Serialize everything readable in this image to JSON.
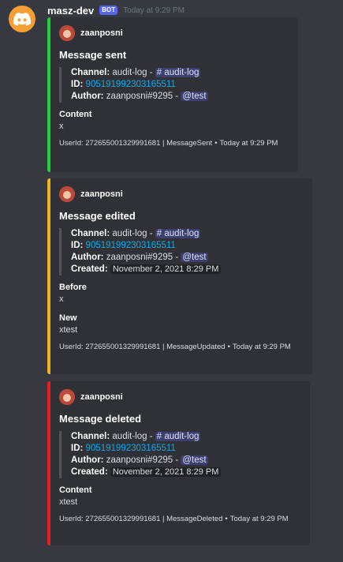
{
  "bot": {
    "name": "masz-dev",
    "tag": "BOT",
    "timestamp": "Today at 9:29 PM",
    "avatar_icon": "discord-logo-icon",
    "avatar_color": "#f59f35"
  },
  "embeds": [
    {
      "color": "#22d13a",
      "author": "zaanposni",
      "title": "Message sent",
      "quote": {
        "channel_label": "Channel:",
        "channel_text": "audit-log -",
        "channel_mention": "# audit-log",
        "id_label": "ID:",
        "id_value": "905191992303165511",
        "author_label": "Author:",
        "author_text": "zaanposni#9295 -",
        "author_mention": "@test"
      },
      "fields": [
        {
          "name": "Content",
          "value": "x"
        }
      ],
      "footer": "UserId: 272655001329991681 | MessageSent",
      "footer_time": "Today at 9:29 PM"
    },
    {
      "color": "#f5b11c",
      "author": "zaanposni",
      "title": "Message edited",
      "quote": {
        "channel_label": "Channel:",
        "channel_text": "audit-log -",
        "channel_mention": "# audit-log",
        "id_label": "ID:",
        "id_value": "905191992303165511",
        "author_label": "Author:",
        "author_text": "zaanposni#9295 -",
        "author_mention": "@test",
        "created_label": "Created:",
        "created_value": "November 2, 2021 8:29 PM"
      },
      "fields": [
        {
          "name": "Before",
          "value": "x"
        },
        {
          "name": "New",
          "value": "xtest"
        }
      ],
      "footer": "UserId: 272655001329991681 | MessageUpdated",
      "footer_time": "Today at 9:29 PM"
    },
    {
      "color": "#ec1e1e",
      "author": "zaanposni",
      "title": "Message deleted",
      "quote": {
        "channel_label": "Channel:",
        "channel_text": "audit-log -",
        "channel_mention": "# audit-log",
        "id_label": "ID:",
        "id_value": "905191992303165511",
        "author_label": "Author:",
        "author_text": "zaanposni#9295 -",
        "author_mention": "@test",
        "created_label": "Created:",
        "created_value": "November 2, 2021 8:29 PM"
      },
      "fields": [
        {
          "name": "Content",
          "value": "xtest"
        }
      ],
      "footer": "UserId: 272655001329991681 | MessageDeleted",
      "footer_time": "Today at 9:29 PM"
    }
  ]
}
